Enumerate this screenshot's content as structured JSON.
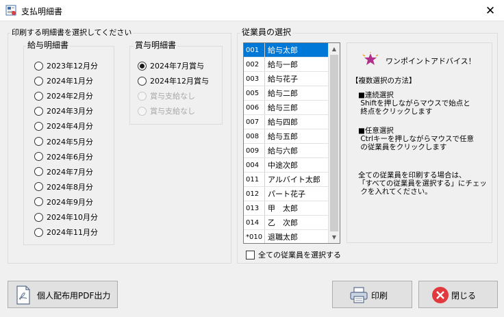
{
  "window": {
    "title": "支払明細書",
    "close_glyph": "✕"
  },
  "print_group": {
    "label": "印刷する明細書を選択してください",
    "salary": {
      "label": "給与明細書",
      "items": [
        {
          "label": "2023年12月分",
          "checked": false
        },
        {
          "label": "2024年1月分",
          "checked": false
        },
        {
          "label": "2024年2月分",
          "checked": false
        },
        {
          "label": "2024年3月分",
          "checked": false
        },
        {
          "label": "2024年4月分",
          "checked": false
        },
        {
          "label": "2024年5月分",
          "checked": false
        },
        {
          "label": "2024年6月分",
          "checked": false
        },
        {
          "label": "2024年7月分",
          "checked": false
        },
        {
          "label": "2024年8月分",
          "checked": false
        },
        {
          "label": "2024年9月分",
          "checked": false
        },
        {
          "label": "2024年10月分",
          "checked": false
        },
        {
          "label": "2024年11月分",
          "checked": false
        }
      ]
    },
    "bonus": {
      "label": "賞与明細書",
      "items": [
        {
          "label": "2024年7月賞与",
          "checked": true,
          "disabled": false
        },
        {
          "label": "2024年12月賞与",
          "checked": false,
          "disabled": false
        },
        {
          "label": "賞与支給なし",
          "checked": false,
          "disabled": true
        },
        {
          "label": "賞与支給なし",
          "checked": false,
          "disabled": true
        }
      ]
    }
  },
  "employees": {
    "label": "従業員の選択",
    "list": [
      {
        "code": "001",
        "name": "給与太郎",
        "selected": true
      },
      {
        "code": "002",
        "name": "給与一郎",
        "selected": false
      },
      {
        "code": "003",
        "name": "給与花子",
        "selected": false
      },
      {
        "code": "005",
        "name": "給与二郎",
        "selected": false
      },
      {
        "code": "006",
        "name": "給与三郎",
        "selected": false
      },
      {
        "code": "007",
        "name": "給与四郎",
        "selected": false
      },
      {
        "code": "008",
        "name": "給与五郎",
        "selected": false
      },
      {
        "code": "009",
        "name": "給与六郎",
        "selected": false
      },
      {
        "code": "004",
        "name": "中途次郎",
        "selected": false
      },
      {
        "code": "011",
        "name": "アルバイト太郎",
        "selected": false
      },
      {
        "code": "012",
        "name": "パート花子",
        "selected": false
      },
      {
        "code": "013",
        "name": "甲　太郎",
        "selected": false
      },
      {
        "code": "014",
        "name": "乙　次郎",
        "selected": false
      },
      {
        "code": "*010",
        "name": "退職太郎",
        "selected": false
      }
    ],
    "select_all_label": "全ての従業員を選択する",
    "select_all_checked": false
  },
  "advice": {
    "title": "ワンポイントアドバイス！",
    "method_heading": "【複数選択の方法】",
    "continuous_heading": "■連続選択",
    "continuous_text": " Shiftを押しながらマウスで始点と\n 終点をクリックします",
    "arbitrary_heading": "■任意選択",
    "arbitrary_text": " Ctrlキーを押しながらマウスで任意\n の従業員をクリックします",
    "all_text": "全ての従業員を印刷する場合は、\n「すべての従業員を選択する」にチェッ\n クを入れてください。"
  },
  "buttons": {
    "pdf": "個人配布用PDF出力",
    "print": "印刷",
    "close": "閉じる"
  },
  "colors": {
    "selection": "#0078d7",
    "close_icon": "#e0393e",
    "advice_icon": "#b0308a"
  }
}
